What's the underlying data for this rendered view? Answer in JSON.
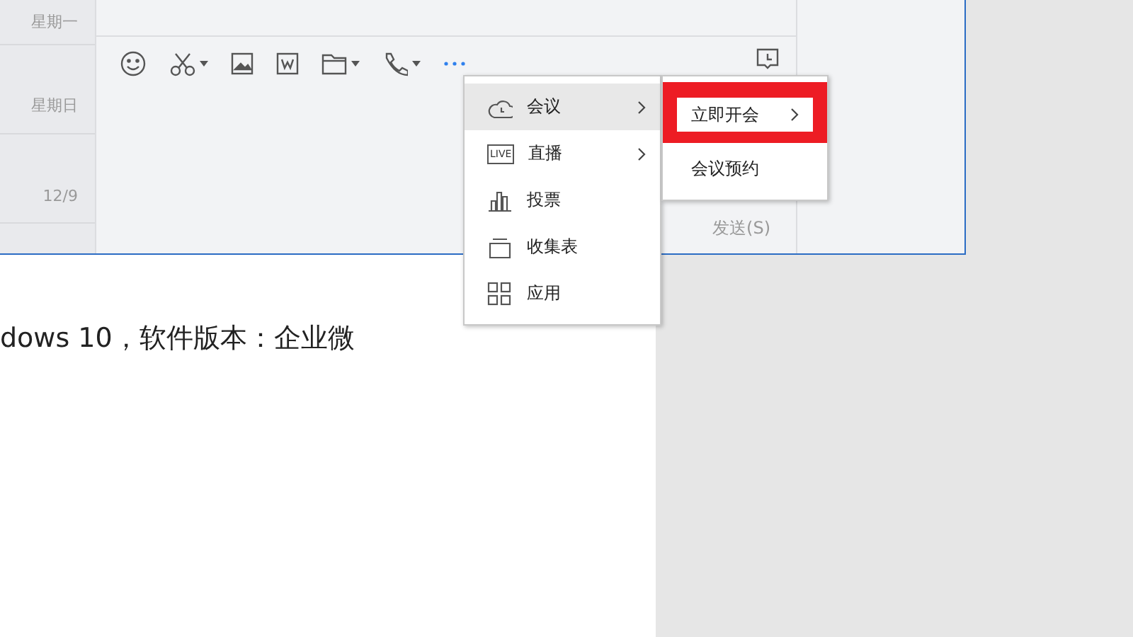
{
  "conversation_list": {
    "dates": [
      "星期一",
      "星期日",
      "12/9"
    ]
  },
  "send_button": "发送(S)",
  "document": {
    "line": "dows 10，软件版本：企业微"
  },
  "menu": {
    "items": [
      {
        "label": "会议",
        "kind": "cloud",
        "submenu": true,
        "selected": true
      },
      {
        "label": "直播",
        "kind": "live",
        "badge": "LIVE",
        "submenu": true,
        "selected": false
      },
      {
        "label": "投票",
        "kind": "chart",
        "submenu": false,
        "selected": false
      },
      {
        "label": "收集表",
        "kind": "tray",
        "submenu": false,
        "selected": false
      },
      {
        "label": "应用",
        "kind": "grid",
        "submenu": false,
        "selected": false
      }
    ]
  },
  "submenu": {
    "items": [
      {
        "label": "立即开会",
        "submenu": true,
        "selected": true
      },
      {
        "label": "会议预约",
        "submenu": false,
        "selected": false
      }
    ]
  }
}
